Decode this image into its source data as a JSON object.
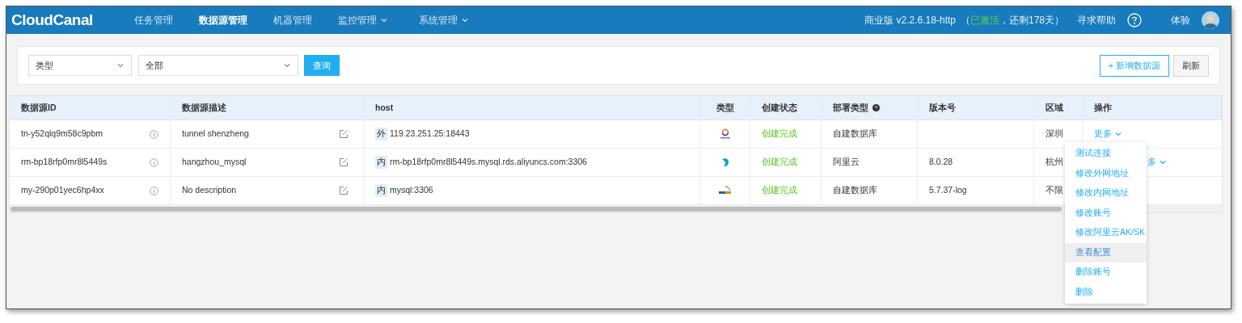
{
  "nav": {
    "logo": "CloudCanal",
    "items": [
      {
        "label": "任务管理",
        "selected": false,
        "dropdown": false
      },
      {
        "label": "数据源管理",
        "selected": true,
        "dropdown": false
      },
      {
        "label": "机器管理",
        "selected": false,
        "dropdown": false
      },
      {
        "label": "监控管理",
        "selected": false,
        "dropdown": true
      },
      {
        "label": "系统管理",
        "selected": false,
        "dropdown": true
      }
    ],
    "version": "商业版 v2.2.6.18-http",
    "license_open": "（",
    "license_status": "已激活",
    "license_rest": "，还剩178天）",
    "help": "寻求帮助",
    "user": "体验"
  },
  "filters": {
    "type_select": "类型",
    "value_select": "全部",
    "query_button": "查询",
    "add_button": "+ 新增数据源",
    "refresh_button": "刷新"
  },
  "table": {
    "columns": [
      "数据源ID",
      "数据源描述",
      "host",
      "类型",
      "创建状态",
      "部署类型",
      "版本号",
      "区域",
      "操作"
    ],
    "rows": [
      {
        "id": "tn-y52qlq9m58c9pbm",
        "description": "tunnel shenzheng",
        "network": "外",
        "host": "119.23.251.25:18443",
        "kind": "canal",
        "status": "创建完成",
        "deploy": "自建数据库",
        "version": "",
        "region": "深圳",
        "action": "更多"
      },
      {
        "id": "rm-bp18rfp0mr8l5449s",
        "description": "hangzhou_mysql",
        "network": "内",
        "host": "rm-bp18rfp0mr8l5449s.mysql.rds.aliyuncs.com:3306",
        "kind": "dolphin",
        "status": "创建完成",
        "deploy": "阿里云",
        "version": "8.0.28",
        "region": "杭州",
        "action": "多"
      },
      {
        "id": "my-290p01yec6hp4xx",
        "description": "No description",
        "network": "内",
        "host": "mysql:3306",
        "kind": "mysql",
        "status": "创建完成",
        "deploy": "自建数据库",
        "version": "5.7.37-log",
        "region": "不限"
      }
    ]
  },
  "menu": [
    {
      "label": "测试连接",
      "selected": false
    },
    {
      "label": "修改外网地址",
      "selected": false
    },
    {
      "label": "修改内网地址",
      "selected": false
    },
    {
      "label": "修改账号",
      "selected": false
    },
    {
      "label": "修改阿里云AK/SK",
      "selected": false
    },
    {
      "label": "查看配置",
      "selected": true
    },
    {
      "label": "删除账号",
      "selected": false
    },
    {
      "label": "删除",
      "selected": false
    }
  ]
}
